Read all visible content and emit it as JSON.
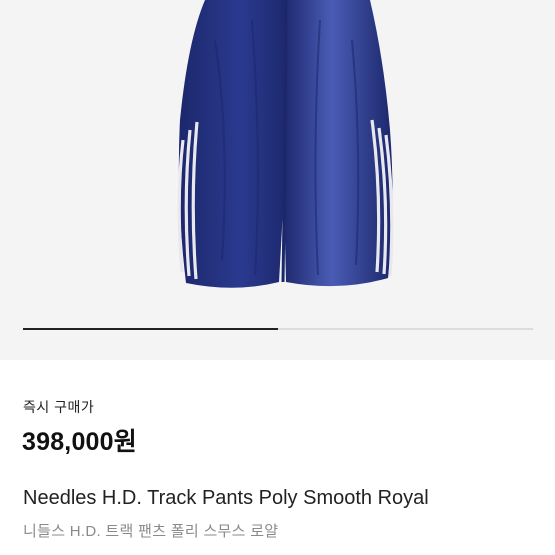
{
  "product": {
    "image_name": "royal-track-pants-photo",
    "image_colors": {
      "fabric": "#2a3a8f",
      "fabric_dark": "#1c276b",
      "fabric_highlight": "#4a5cb5",
      "stripe": "#e8e8ee",
      "background": "#f4f4f4"
    },
    "gallery_progress": 0.5,
    "price_label": "즉시 구매가",
    "price": "398,000원",
    "name_en": "Needles H.D. Track Pants Poly Smooth Royal",
    "name_ko": "니들스 H.D. 트랙 팬츠 폴리 스무스 로얄"
  }
}
